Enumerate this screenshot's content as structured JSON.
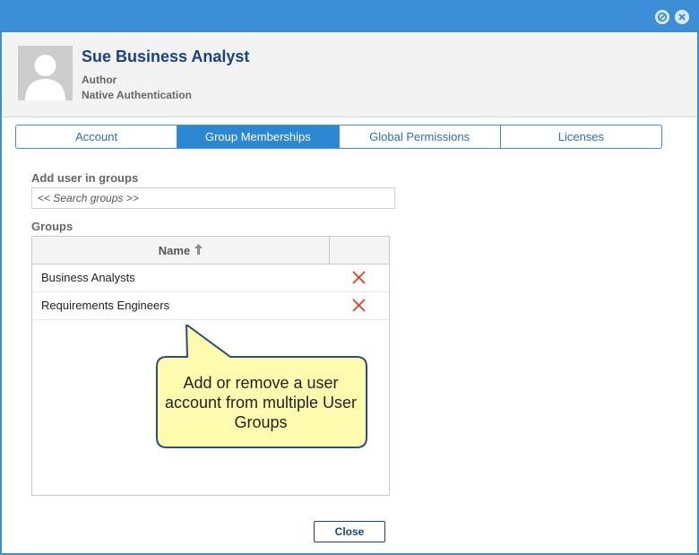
{
  "window": {
    "minimize_icon": "circle-slash-icon",
    "close_icon": "circle-close-icon",
    "accent_color": "#3c8ed6"
  },
  "user": {
    "name": "Sue Business Analyst",
    "role": "Author",
    "authentication": "Native Authentication",
    "avatar_icon": "user-silhouette-icon"
  },
  "tabs": [
    {
      "label": "Account",
      "active": false
    },
    {
      "label": "Group Memberships",
      "active": true
    },
    {
      "label": "Global Permissions",
      "active": false
    },
    {
      "label": "Licenses",
      "active": false
    }
  ],
  "add_section": {
    "label": "Add user in groups",
    "search_placeholder": "<< Search groups >>"
  },
  "groups_section": {
    "label": "Groups",
    "column_name": "Name",
    "sort_icon": "arrow-up-icon",
    "rows": [
      {
        "name": "Business Analysts",
        "delete_icon": "red-x-icon"
      },
      {
        "name": "Requirements Engineers",
        "delete_icon": "red-x-icon"
      }
    ]
  },
  "callout": {
    "text": "Add or remove a user account from multiple User Groups",
    "fill_color": "#fffcb0",
    "border_color": "#2a4f7d"
  },
  "footer": {
    "close_label": "Close"
  }
}
